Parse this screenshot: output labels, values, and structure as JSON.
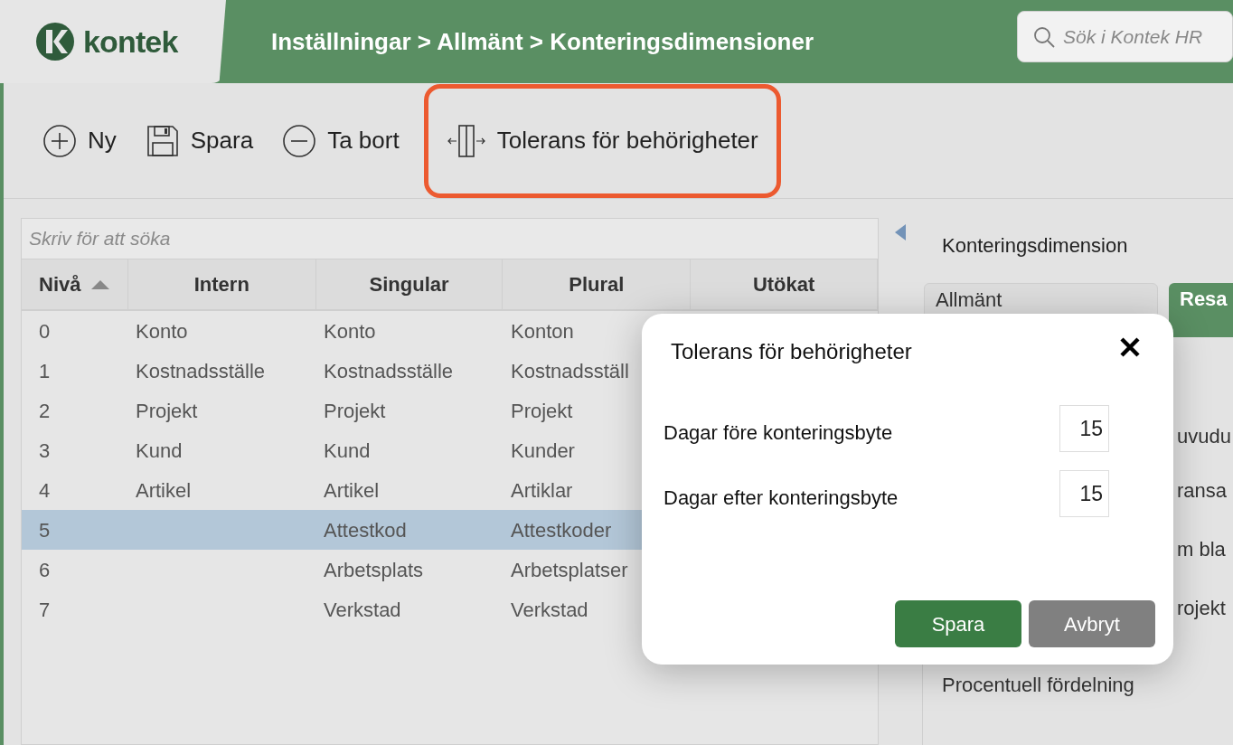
{
  "header": {
    "logo": "kontek",
    "breadcrumb": "Inställningar > Allmänt > Konteringsdimensioner",
    "search": {
      "placeholder": "Sök i Kontek HR"
    }
  },
  "toolbar": [
    {
      "kind": "new",
      "label": "Ny",
      "highlighted": false
    },
    {
      "kind": "save",
      "label": "Spara",
      "highlighted": false
    },
    {
      "kind": "delete",
      "label": "Ta bort",
      "highlighted": false
    },
    {
      "kind": "tolerance",
      "label": "Tolerans för behörigheter",
      "highlighted": true
    }
  ],
  "table": {
    "search": {
      "placeholder": "Skriv för att söka"
    },
    "columns": [
      {
        "label": "Nivå",
        "sorted": true
      },
      {
        "label": "Intern",
        "sorted": false
      },
      {
        "label": "Singular",
        "sorted": false
      },
      {
        "label": "Plural",
        "sorted": false
      },
      {
        "label": "Utökat",
        "sorted": false
      }
    ],
    "rows": [
      {
        "cells": [
          "0",
          "Konto",
          "Konto",
          "Konton"
        ],
        "selected": false
      },
      {
        "cells": [
          "1",
          "Kostnadsställe",
          "Kostnadsställe",
          "Kostnadsställ"
        ],
        "selected": false
      },
      {
        "cells": [
          "2",
          "Projekt",
          "Projekt",
          "Projekt"
        ],
        "selected": false
      },
      {
        "cells": [
          "3",
          "Kund",
          "Kund",
          "Kunder"
        ],
        "selected": false
      },
      {
        "cells": [
          "4",
          "Artikel",
          "Artikel",
          "Artiklar"
        ],
        "selected": false
      },
      {
        "cells": [
          "5",
          "",
          "Attestkod",
          "Attestkoder"
        ],
        "selected": true
      },
      {
        "cells": [
          "6",
          "",
          "Arbetsplats",
          "Arbetsplatser"
        ],
        "selected": false
      },
      {
        "cells": [
          "7",
          "",
          "Verkstad",
          "Verkstad"
        ],
        "selected": false
      }
    ]
  },
  "detail": {
    "title": "Konteringsdimension",
    "tabs": [
      {
        "label": "Allmänt",
        "selected": false
      },
      {
        "label": "Resa",
        "selected": true
      }
    ],
    "items": [
      {
        "label": "uvudu",
        "kind": "partial"
      },
      {
        "label": "ransa",
        "kind": "partial"
      },
      {
        "label": "m bla",
        "kind": "partial"
      },
      {
        "label": "rojekt",
        "kind": "partial"
      },
      {
        "label": "Procentuell fördelning",
        "kind": "full"
      }
    ]
  },
  "dialog": {
    "title": "Tolerans för behörigheter",
    "fields": [
      {
        "label": "Dagar före konteringsbyte",
        "value": "15"
      },
      {
        "label": "Dagar efter konteringsbyte",
        "value": "15"
      }
    ],
    "buttons": [
      {
        "kind": "primary",
        "label": "Spara"
      },
      {
        "kind": "secondary",
        "label": "Avbryt"
      }
    ]
  }
}
